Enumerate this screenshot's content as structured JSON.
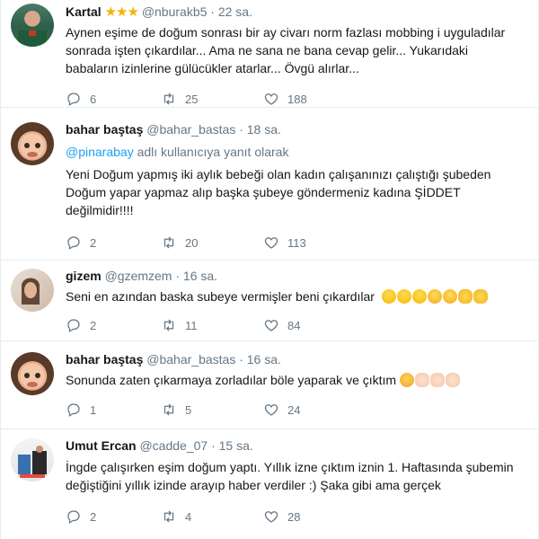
{
  "tweets": [
    {
      "name": "Kartal",
      "badge": "★★★",
      "handle": "@nburakb5",
      "time": "· 22 sa.",
      "text": "Aynen eşime de doğum sonrası bir ay civarı norm fazlası mobbing i uyguladılar sonrada işten çıkardılar... Ama ne sana ne bana cevap gelir... Yukarıdaki babaların izinlerine gülücükler atarlar... Övgü alırlar...",
      "replies": "6",
      "retweets": "25",
      "likes": "188"
    },
    {
      "name": "bahar baştaş",
      "handle": "@bahar_bastas",
      "time": "· 18 sa.",
      "reply_mention": "@pinarabay",
      "reply_suffix": " adlı kullanıcıya yanıt olarak",
      "text": "Yeni Doğum yapmış  iki aylık bebeği olan kadın çalışanınızı çalıştığı şubeden Doğum yapar yapmaz alıp başka şubeye göndermeniz kadına ŞİDDET değilmidir!!!!",
      "replies": "2",
      "retweets": "20",
      "likes": "113"
    },
    {
      "name": "gizem",
      "handle": "@gzemzem",
      "time": "· 16 sa.",
      "text": "Seni en azından baska subeye vermişler beni çıkardılar",
      "emoji": [
        "laugh",
        "laugh",
        "laugh",
        "wink",
        "wink",
        "clap",
        "clap"
      ],
      "replies": "2",
      "retweets": "11",
      "likes": "84"
    },
    {
      "name": "bahar baştaş",
      "handle": "@bahar_bastas",
      "time": "· 16 sa.",
      "text": "Sonunda zaten çıkarmaya zorladılar böle yaparak ve çıktım",
      "emoji": [
        "sad",
        "pale",
        "pale",
        "pale"
      ],
      "replies": "1",
      "retweets": "5",
      "likes": "24"
    },
    {
      "name": "Umut Ercan",
      "handle": "@cadde_07",
      "time": "· 15 sa.",
      "text": "İngde çalışırken eşim doğum yaptı. Yıllık izne çıktım iznin 1. Haftasında şubemin değiştiğini yıllık izinde arayıp haber verdiler :) Şaka gibi ama gerçek",
      "replies": "2",
      "retweets": "4",
      "likes": "28"
    }
  ],
  "icons": {
    "reply": "reply-icon",
    "retweet": "retweet-icon",
    "like": "heart-icon"
  },
  "colors": {
    "link": "#1da1f2",
    "secondary_text": "#657786",
    "border": "#e6ecf0",
    "star": "#f5b400"
  }
}
